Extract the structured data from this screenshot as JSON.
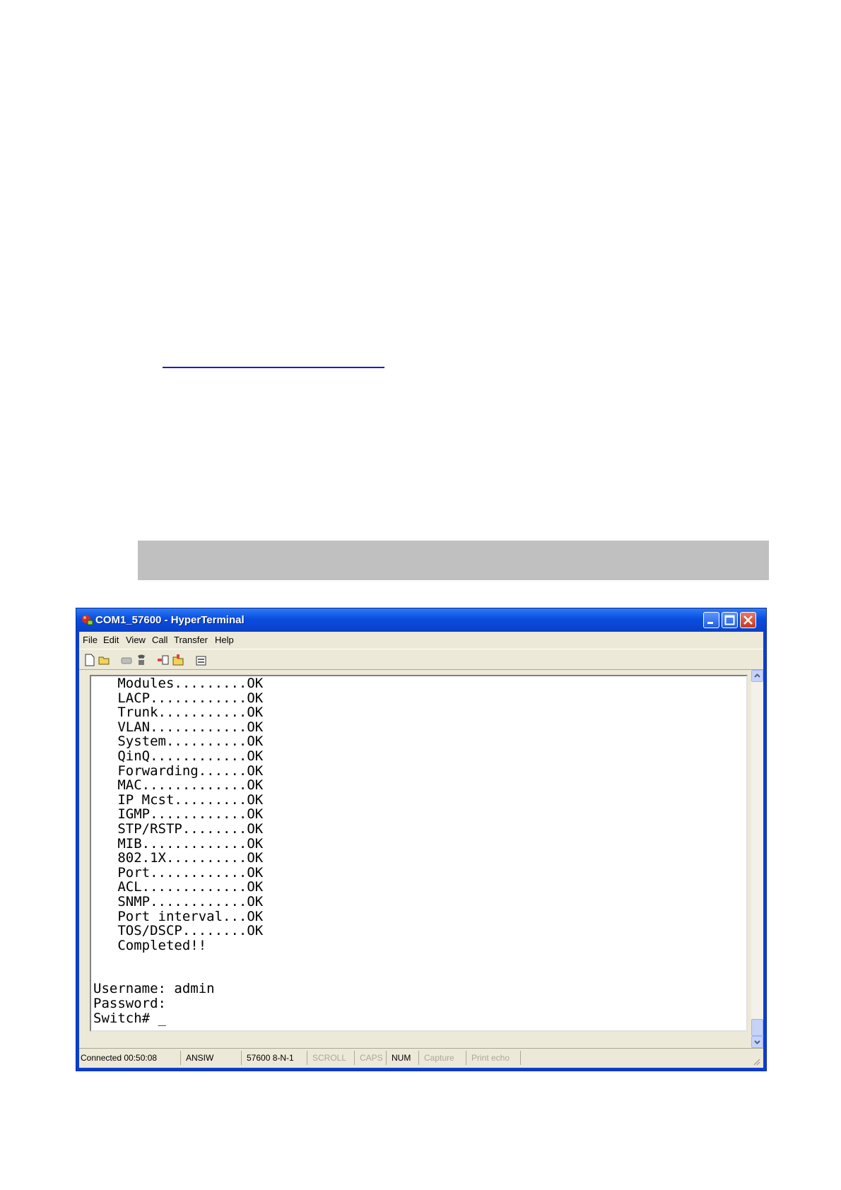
{
  "window": {
    "title": "COM1_57600 - HyperTerminal"
  },
  "menu": [
    "File",
    "Edit",
    "View",
    "Call",
    "Transfer",
    "Help"
  ],
  "toolbar": {
    "icons": [
      "new-icon",
      "open-icon",
      "disconnect-icon",
      "dial-icon",
      "send-icon",
      "receive-icon",
      "properties-icon"
    ]
  },
  "terminal": {
    "lines": [
      "   Modules.........OK",
      "   LACP............OK",
      "   Trunk...........OK",
      "   VLAN............OK",
      "   System..........OK",
      "   QinQ............OK",
      "   Forwarding......OK",
      "   MAC.............OK",
      "   IP Mcst.........OK",
      "   IGMP............OK",
      "   STP/RSTP........OK",
      "   MIB.............OK",
      "   802.1X..........OK",
      "   Port............OK",
      "   ACL.............OK",
      "   SNMP............OK",
      "   Port interval...OK",
      "   TOS/DSCP........OK",
      "   Completed!!",
      "",
      "",
      "Username: admin",
      "Password:",
      "Switch# _"
    ]
  },
  "status": {
    "connected": "Connected 00:50:08",
    "emulation": "ANSIW",
    "settings": "57600 8-N-1",
    "scroll": "SCROLL",
    "caps": "CAPS",
    "num": "NUM",
    "capture": "Capture",
    "print_echo": "Print echo"
  },
  "colors": {
    "titlebar": "#0a4de0",
    "chrome": "#ece9d8",
    "link_underline": "#1d1dcc",
    "banner_gray": "#c0c0c0"
  }
}
